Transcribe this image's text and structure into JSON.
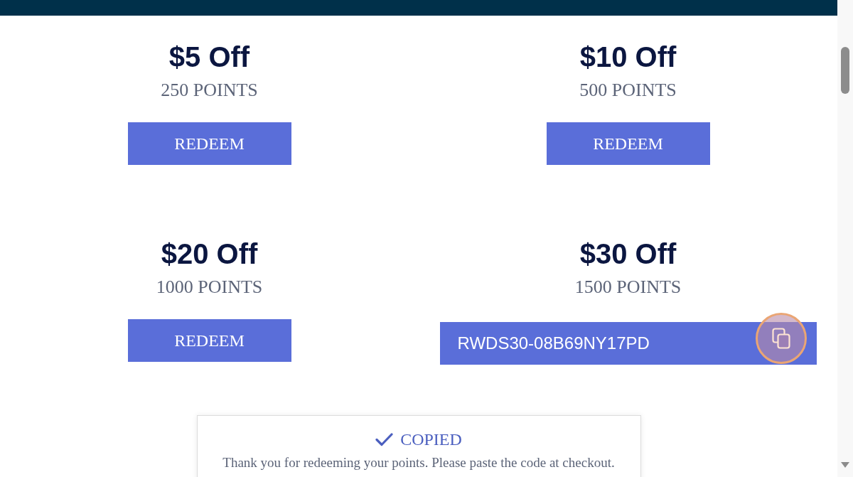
{
  "rewards": [
    {
      "kind": "button",
      "title": "$5 Off",
      "points": "250 POINTS",
      "action": "REDEEM"
    },
    {
      "kind": "button",
      "title": "$10 Off",
      "points": "500 POINTS",
      "action": "REDEEM"
    },
    {
      "kind": "button",
      "title": "$20 Off",
      "points": "1000 POINTS",
      "action": "REDEEM"
    },
    {
      "kind": "code",
      "title": "$30 Off",
      "points": "1500 POINTS",
      "code": "RWDS30-08B69NY17PD",
      "highlighted": true
    }
  ],
  "toast": {
    "status": "COPIED",
    "message": "Thank you for redeeming your points. Please paste the code at checkout."
  }
}
